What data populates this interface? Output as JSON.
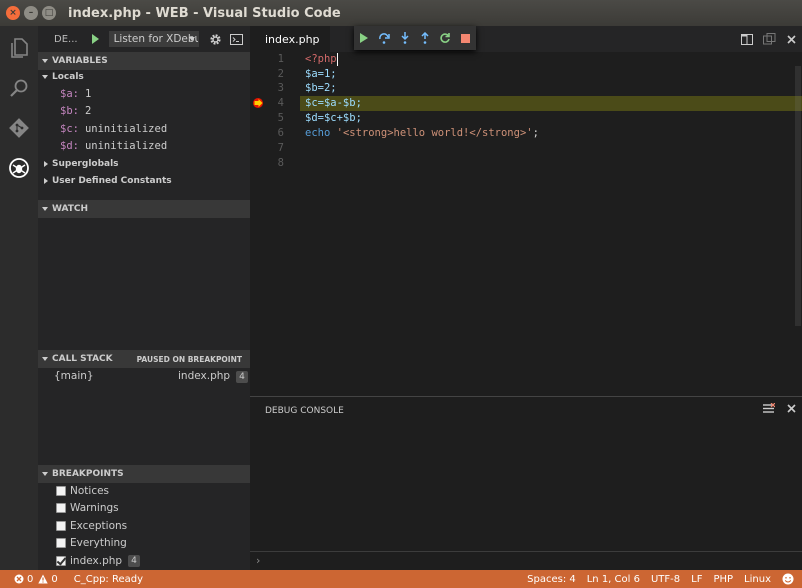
{
  "window": {
    "title": "index.php - WEB - Visual Studio Code"
  },
  "debug_toolbar": {
    "label": "DE...",
    "config_selected": "Listen for XDebug"
  },
  "variables": {
    "header": "VARIABLES",
    "scopes": [
      {
        "label": "Locals",
        "expanded": true
      },
      {
        "label": "Superglobals",
        "expanded": false
      },
      {
        "label": "User Defined Constants",
        "expanded": false
      }
    ],
    "locals": [
      {
        "name": "$a:",
        "value": "1"
      },
      {
        "name": "$b:",
        "value": "2"
      },
      {
        "name": "$c:",
        "value": "uninitialized"
      },
      {
        "name": "$d:",
        "value": "uninitialized"
      }
    ]
  },
  "watch": {
    "header": "WATCH"
  },
  "call_stack": {
    "header": "CALL STACK",
    "status": "PAUSED ON BREAKPOINT",
    "frames": [
      {
        "name": "{main}",
        "file": "index.php",
        "line": "4"
      }
    ]
  },
  "breakpoints": {
    "header": "BREAKPOINTS",
    "items": [
      {
        "label": "Notices",
        "checked": false
      },
      {
        "label": "Warnings",
        "checked": false
      },
      {
        "label": "Exceptions",
        "checked": false
      },
      {
        "label": "Everything",
        "checked": false
      },
      {
        "label": "index.php",
        "checked": true,
        "badge": "4"
      }
    ]
  },
  "editor": {
    "tab_label": "index.php",
    "line_numbers": [
      "1",
      "2",
      "3",
      "4",
      "5",
      "6",
      "7",
      "8"
    ],
    "code": {
      "line1": "<?php",
      "line2": "$a=1;",
      "line3": "$b=2;",
      "line4": "$c=$a-$b;",
      "line5": "$d=$c+$b;",
      "line6_kw": "echo",
      "line6_str": "'<strong>hello world!</strong>'",
      "line6_end": ";"
    }
  },
  "panel": {
    "title": "DEBUG CONSOLE",
    "prompt": "›"
  },
  "status_bar": {
    "errors": "0",
    "warnings": "0",
    "c_cpp": "C_Cpp: Ready",
    "spaces": "Spaces: 4",
    "position": "Ln 1, Col 6",
    "encoding": "UTF-8",
    "eol": "LF",
    "language": "PHP",
    "os": "Linux"
  },
  "colors": {
    "status_bar_bg": "#cc6633",
    "current_line_bg": "#4b4b18",
    "breakpoint": "#e51400",
    "continue_green": "#89d185",
    "stop_red": "#f48771"
  }
}
